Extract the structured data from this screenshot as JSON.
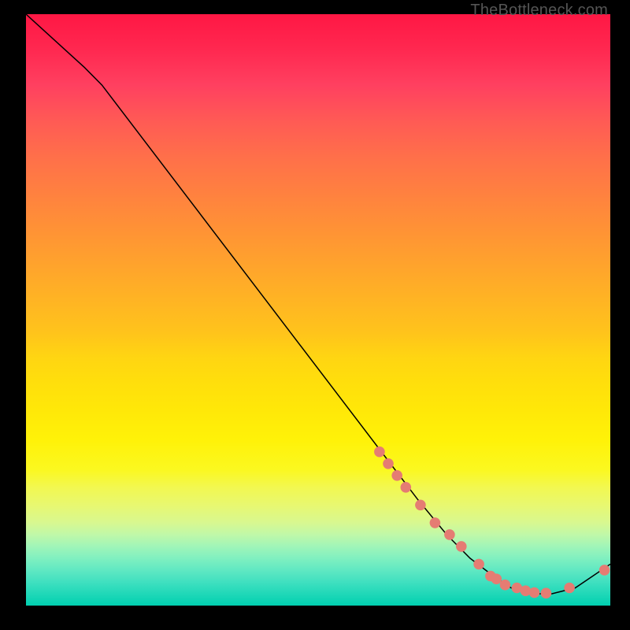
{
  "watermark": "TheBottleneck.com",
  "chart_data": {
    "type": "line",
    "title": "",
    "xlabel": "",
    "ylabel": "",
    "xlim": [
      0,
      100
    ],
    "ylim": [
      0,
      100
    ],
    "grid": false,
    "series": [
      {
        "name": "curve",
        "x": [
          0,
          10,
          13,
          67,
          72,
          76,
          80,
          83,
          86,
          90,
          94,
          97,
          100
        ],
        "values": [
          100,
          91,
          88,
          18,
          12,
          8,
          5,
          3,
          2,
          2,
          3,
          5,
          7
        ]
      }
    ],
    "markers": {
      "name": "highlighted-points",
      "x": [
        60.5,
        62,
        63.5,
        65,
        67.5,
        70,
        72.5,
        74.5,
        77.5,
        79.5,
        80.5,
        82,
        84,
        85.5,
        87,
        89,
        93,
        99
      ],
      "values": [
        26,
        24,
        22,
        20,
        17,
        14,
        12,
        10,
        7,
        5,
        4.5,
        3.5,
        3,
        2.5,
        2.2,
        2.1,
        3,
        6
      ]
    }
  },
  "colors": {
    "marker_fill": "#e57c73",
    "curve_stroke": "#000000"
  }
}
